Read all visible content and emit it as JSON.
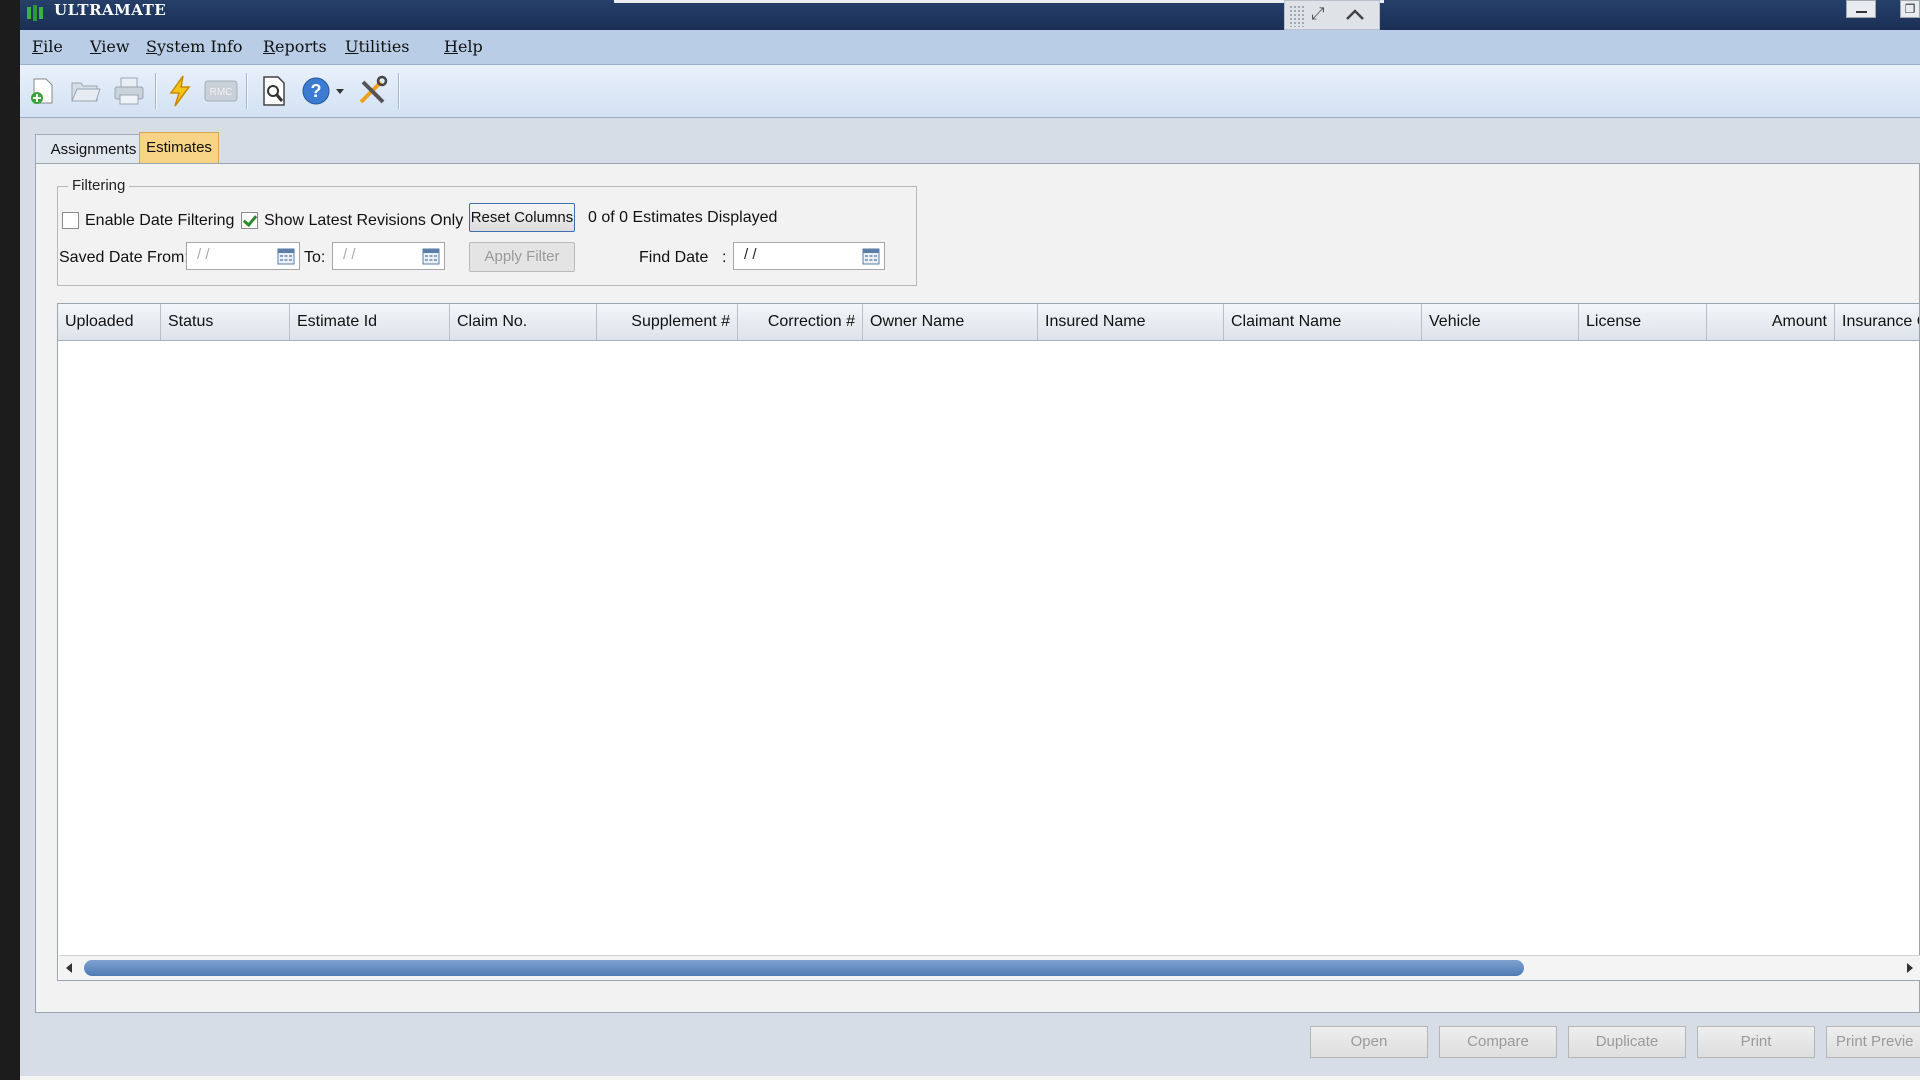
{
  "app": {
    "title": "ULTRAMATE"
  },
  "menu": [
    {
      "u": "F",
      "rest": "ile"
    },
    {
      "u": "V",
      "rest": "iew"
    },
    {
      "u": "S",
      "rest": "ystem Info"
    },
    {
      "u": "R",
      "rest": "eports"
    },
    {
      "u": "U",
      "rest": "tilities"
    },
    {
      "u": "H",
      "rest": "elp"
    }
  ],
  "toolbar": {
    "rmc_label": "RMC"
  },
  "tabs": {
    "assignments": "Assignments",
    "estimates": "Estimates",
    "active": "Estimates"
  },
  "filtering": {
    "legend": "Filtering",
    "enable_date_filtering": {
      "label": "Enable Date Filtering",
      "checked": false
    },
    "show_latest_revisions": {
      "label": "Show Latest Revisions Only",
      "checked": true
    },
    "reset_columns": "Reset Columns",
    "count_text": "0 of 0 Estimates Displayed",
    "saved_date_from_label": "Saved Date From:",
    "saved_date_from_value": "/ /",
    "to_label": "To:",
    "to_value": "/ /",
    "apply_filter": "Apply Filter",
    "find_date_label": "Find Date",
    "find_date_colon": ":",
    "find_date_value": "/ /"
  },
  "grid": {
    "columns": [
      "Uploaded",
      "Status",
      "Estimate Id",
      "Claim No.",
      "Supplement #",
      "Correction #",
      "Owner Name",
      "Insured Name",
      "Claimant Name",
      "Vehicle",
      "License",
      "Amount",
      "Insurance C"
    ],
    "rows": []
  },
  "buttons": {
    "open": "Open",
    "compare": "Compare",
    "duplicate": "Duplicate",
    "print": "Print",
    "print_preview": "Print Previe"
  }
}
